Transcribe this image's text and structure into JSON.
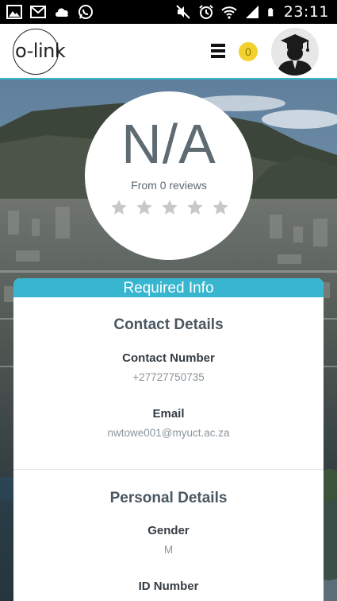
{
  "status_bar": {
    "time": "23:11",
    "left_icons": [
      "image-icon",
      "mail-icon",
      "cloud-icon",
      "whatsapp-icon"
    ],
    "right_icons": [
      "mute-icon",
      "alarm-icon",
      "wifi-icon",
      "signal-icon",
      "battery-icon"
    ]
  },
  "header": {
    "logo_text": "o-link",
    "menu_icon": "hamburger-menu-icon",
    "notification_count": "0",
    "avatar_icon": "graduate-avatar-icon"
  },
  "rating": {
    "value": "N/A",
    "reviews_text": "From 0 reviews",
    "stars_filled": 0,
    "stars_total": 5
  },
  "card": {
    "header": "Required Info",
    "contact": {
      "title": "Contact Details",
      "number_label": "Contact Number",
      "number_value": "+27727750735",
      "email_label": "Email",
      "email_value": "nwtowe001@myuct.ac.za"
    },
    "personal": {
      "title": "Personal Details",
      "gender_label": "Gender",
      "gender_value": "M",
      "id_label": "ID Number"
    }
  },
  "colors": {
    "accent": "#38b6cf",
    "badge": "#f3d12c",
    "star_empty": "#c8c8c8",
    "text_dark": "#4a5761",
    "text_muted": "#8a959c"
  }
}
